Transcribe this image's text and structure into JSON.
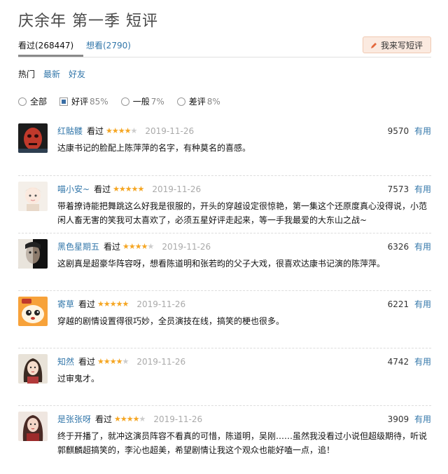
{
  "page": {
    "title": "庆余年 第一季 短评"
  },
  "tabs": [
    {
      "label": "看过(268447)"
    },
    {
      "label": "想看(2790)"
    }
  ],
  "write_button": {
    "label": "我来写短评",
    "icon": "pencil-icon",
    "color": "#e4683d"
  },
  "sort": [
    "热门",
    "最新",
    "好友"
  ],
  "filters": [
    {
      "label": "全部",
      "pct": ""
    },
    {
      "label": "好评",
      "pct": "85%"
    },
    {
      "label": "一般",
      "pct": "7%"
    },
    {
      "label": "差评",
      "pct": "8%"
    }
  ],
  "reviews": [
    {
      "user": "红骷髅",
      "status": "看过",
      "rating": 4,
      "date": "2019-11-26",
      "votes": "9570",
      "useful": "有用",
      "text": "达康书记的脸配上陈萍萍的名字，有种莫名的喜感。"
    },
    {
      "user": "喵小安~",
      "status": "看过",
      "rating": 5,
      "date": "2019-11-26",
      "votes": "7573",
      "useful": "有用",
      "text": "带着撩诗能把舞跳这么好我是很服的，开头的穿越设定很惊艳，第一集这个还原度真心没得说，小范闲人畜无害的笑我可太喜欢了，必须五星好评走起来，等一手我最爱的大东山之战~"
    },
    {
      "user": "黑色星期五",
      "status": "看过",
      "rating": 4,
      "date": "2019-11-26",
      "votes": "6326",
      "useful": "有用",
      "text": "这剧真是超豪华阵容呀，想看陈道明和张若昀的父子大戏，很喜欢达康书记演的陈萍萍。"
    },
    {
      "user": "寄草",
      "status": "看过",
      "rating": 5,
      "date": "2019-11-26",
      "votes": "6221",
      "useful": "有用",
      "text": "穿越的剧情设置得很巧妙，全员演技在线，搞笑的梗也很多。"
    },
    {
      "user": "知然",
      "status": "看过",
      "rating": 4,
      "date": "2019-11-26",
      "votes": "4742",
      "useful": "有用",
      "text": "过审鬼才。"
    },
    {
      "user": "是张张呀",
      "status": "看过",
      "rating": 4,
      "date": "2019-11-26",
      "votes": "3909",
      "useful": "有用",
      "text": "终于开播了，就冲这演员阵容不看真的可惜，陈道明，吴刚……虽然我没看过小说但超级期待，听说郭麒麟超搞笑的，李沁也超美，希望剧情让我这个观众也能好嗑一点，追！"
    }
  ]
}
